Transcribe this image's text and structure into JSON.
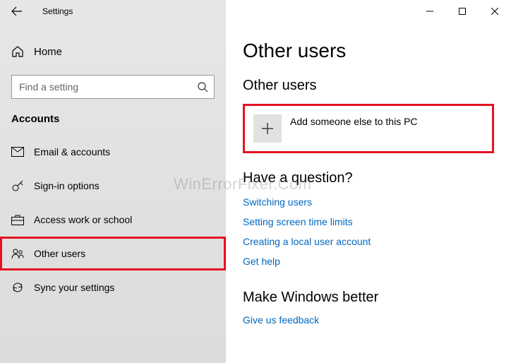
{
  "app": {
    "title": "Settings"
  },
  "sidebar": {
    "home": "Home",
    "search_placeholder": "Find a setting",
    "section": "Accounts",
    "items": [
      {
        "label": "Email & accounts",
        "icon": "mail-icon"
      },
      {
        "label": "Sign-in options",
        "icon": "key-icon"
      },
      {
        "label": "Access work or school",
        "icon": "briefcase-icon"
      },
      {
        "label": "Other users",
        "icon": "users-icon"
      },
      {
        "label": "Sync your settings",
        "icon": "sync-icon"
      }
    ]
  },
  "main": {
    "title": "Other users",
    "section_heading": "Other users",
    "add_label": "Add someone else to this PC",
    "question_heading": "Have a question?",
    "links": [
      "Switching users",
      "Setting screen time limits",
      "Creating a local user account",
      "Get help"
    ],
    "better_heading": "Make Windows better",
    "feedback": "Give us feedback"
  },
  "watermark": "WinErrorFixer.Com"
}
